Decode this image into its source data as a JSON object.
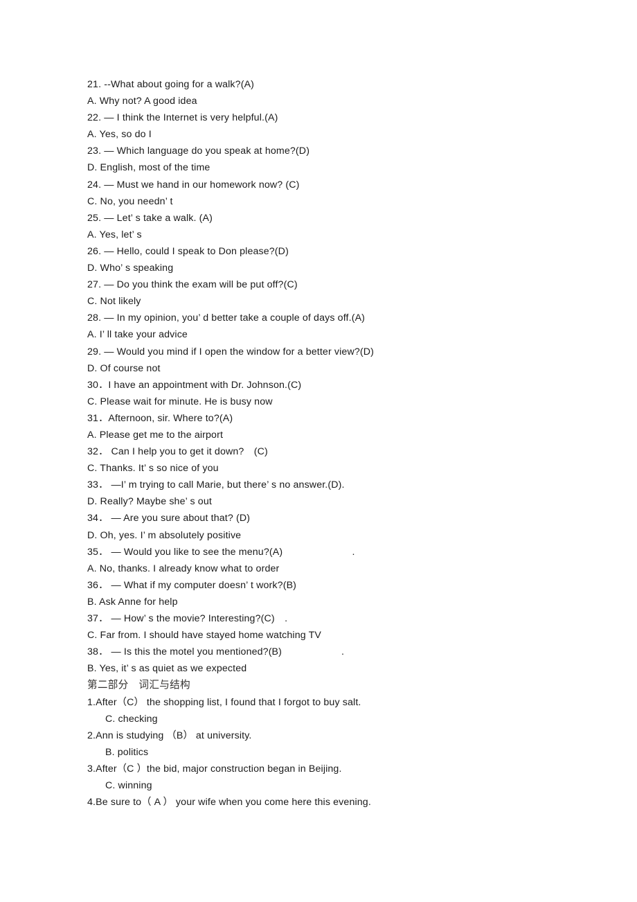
{
  "document": {
    "page_background": "#ffffff",
    "text_color": "#1a1a1a",
    "heading_color": "#33312f",
    "section_heading": "第二部分　词汇与结构",
    "lines": [
      {
        "id": "q21",
        "text": "21. --What about going for a walk?(A)"
      },
      {
        "id": "a21",
        "text": "A. Why not? A good idea"
      },
      {
        "id": "q22",
        "text": "22. — I think the Internet is very helpful.(A)"
      },
      {
        "id": "a22",
        "text": "A. Yes, so do I"
      },
      {
        "id": "q23",
        "text": "23. — Which language do you speak at home?(D)"
      },
      {
        "id": "a23",
        "text": "D. English, most of the time"
      },
      {
        "id": "q24",
        "text": "24. — Must we hand in our homework now? (C)"
      },
      {
        "id": "a24",
        "text": "C. No, you needn’ t"
      },
      {
        "id": "q25",
        "text": "25. — Let’ s take a walk. (A)"
      },
      {
        "id": "a25",
        "text": "A. Yes, let’ s"
      },
      {
        "id": "q26",
        "text": "26. — Hello, could I speak to Don please?(D)"
      },
      {
        "id": "a26",
        "text": "D. Who’ s speaking"
      },
      {
        "id": "q27",
        "text": "27. — Do you think the exam will be put off?(C)"
      },
      {
        "id": "a27",
        "text": "C. Not likely"
      },
      {
        "id": "q28",
        "text": "28. — In my opinion, you’ d better take a couple of days off.(A)"
      },
      {
        "id": "a28",
        "text": "A. I’ ll take your advice"
      },
      {
        "id": "q29",
        "text": "29. — Would you mind if I open the window for a better view?(D)"
      },
      {
        "id": "a29",
        "text": "D. Of course not"
      },
      {
        "id": "q30",
        "text": "30．I have an appointment with Dr. Johnson.(C)"
      },
      {
        "id": "a30",
        "text": "C. Please wait for minute. He is busy now"
      },
      {
        "id": "q31",
        "text": "31．Afternoon, sir. Where to?(A)"
      },
      {
        "id": "a31",
        "text": "A. Please get me to the airport"
      },
      {
        "id": "q32",
        "text": "32． Can I help you to get it down?　(C)"
      },
      {
        "id": "a32",
        "text": "C. Thanks. It’ s so nice of you"
      },
      {
        "id": "q33",
        "text": "33． —I’ m trying to call Marie, but there’ s no answer.(D)."
      },
      {
        "id": "a33",
        "text": "D. Really? Maybe she’ s out"
      },
      {
        "id": "q34",
        "text": "34． — Are you sure about that? (D)"
      },
      {
        "id": "a34",
        "text": "D. Oh, yes. I’ m absolutely positive"
      },
      {
        "id": "q35",
        "text": "35． — Would you like to see the menu?(A)",
        "tail": "　　　　　　　."
      },
      {
        "id": "a35",
        "text": "A. No, thanks. I already know what to order"
      },
      {
        "id": "q36",
        "text": "36． — What if my computer doesn’ t work?(B)"
      },
      {
        "id": "a36",
        "text": "B. Ask Anne for help"
      },
      {
        "id": "q37",
        "text": "37． — How’ s the movie? Interesting?(C)",
        "tail": "　."
      },
      {
        "id": "a37",
        "text": "C. Far from. I should have stayed home watching TV"
      },
      {
        "id": "q38",
        "text": "38． — Is this the motel you mentioned?(B)",
        "tail": "　　　　　　."
      },
      {
        "id": "a38",
        "text": "B. Yes, it’ s as quiet as we expected"
      },
      {
        "id": "heading-part2",
        "text": "第二部分　词汇与结构",
        "style": "cn-heading"
      },
      {
        "id": "v1",
        "text": "1.After（C） the shopping list, I found that I forgot to buy salt."
      },
      {
        "id": "v1a",
        "text": "C. checking",
        "style": "indent"
      },
      {
        "id": "v2",
        "text": "2.Ann is studying （B） at university."
      },
      {
        "id": "v2a",
        "text": "B. politics",
        "style": "indent"
      },
      {
        "id": "v3",
        "text": "3.After（C ）the bid, major construction began in Beijing."
      },
      {
        "id": "v3a",
        "text": "C. winning",
        "style": "indent"
      },
      {
        "id": "v4",
        "text": "4.Be sure to（ A ） your wife when you come here this evening."
      }
    ]
  }
}
